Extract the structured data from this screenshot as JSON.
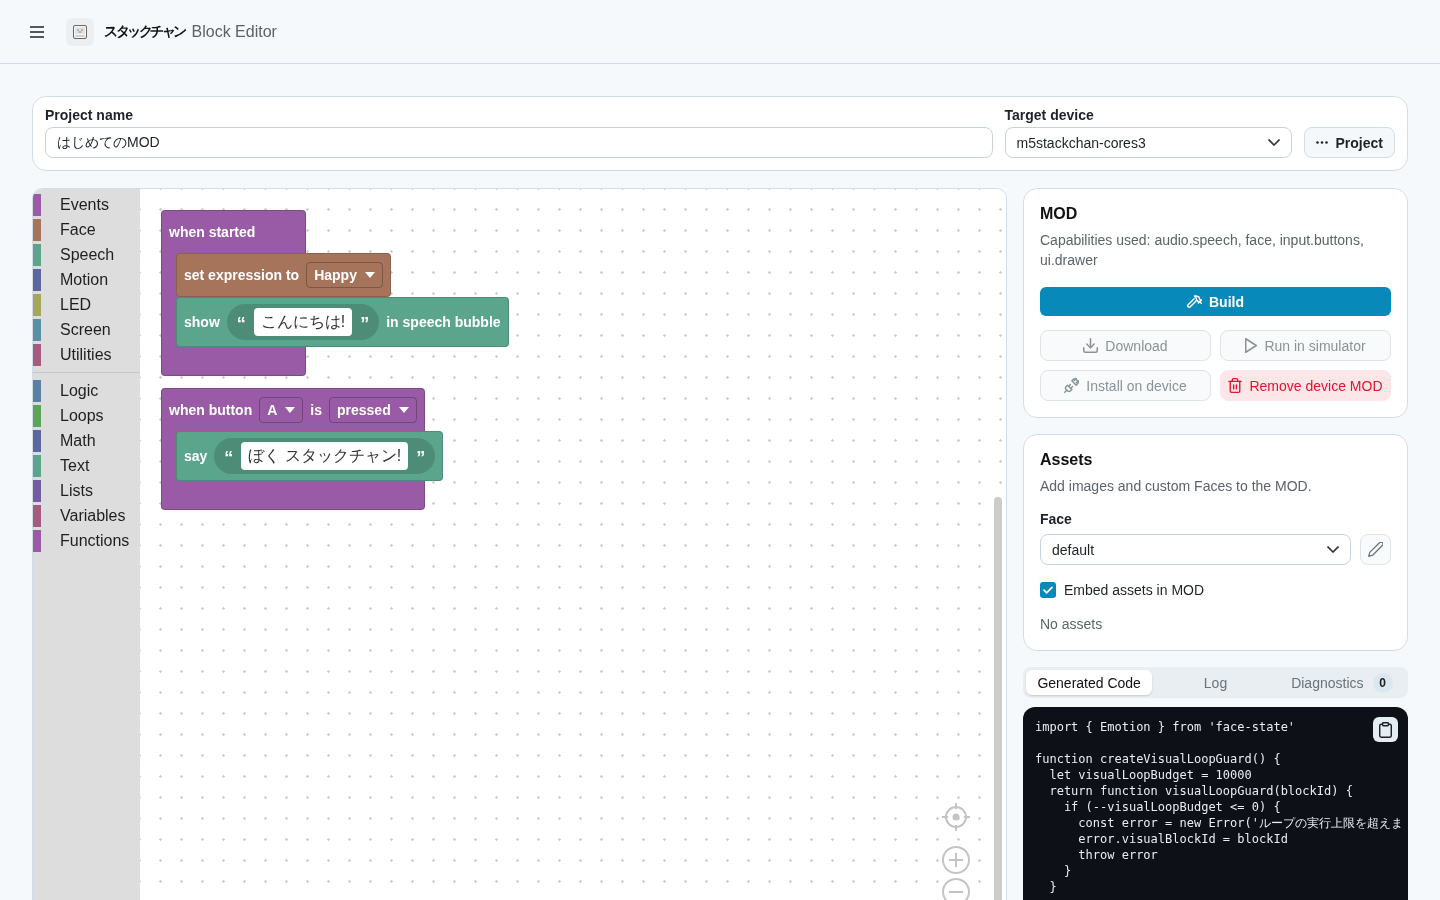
{
  "header": {
    "brand": "スタックチャン",
    "title": "Block Editor"
  },
  "project": {
    "name_label": "Project name",
    "name_value": "はじめてのMOD",
    "device_label": "Target device",
    "device_value": "m5stackchan-cores3",
    "menu_button": "Project"
  },
  "workspace": {
    "toolbox": {
      "sections": [
        {
          "categories": [
            {
              "label": "Events",
              "color": "#995ba5"
            },
            {
              "label": "Face",
              "color": "#a5745b"
            },
            {
              "label": "Speech",
              "color": "#5ba58c"
            },
            {
              "label": "Motion",
              "color": "#5b67a5"
            },
            {
              "label": "LED",
              "color": "#a5a55b"
            },
            {
              "label": "Screen",
              "color": "#5b8fa5"
            },
            {
              "label": "Utilities",
              "color": "#a55b80"
            }
          ]
        },
        {
          "categories": [
            {
              "label": "Logic",
              "color": "#5b80a5"
            },
            {
              "label": "Loops",
              "color": "#5ba55b"
            },
            {
              "label": "Math",
              "color": "#5b67a5"
            },
            {
              "label": "Text",
              "color": "#5ba58c"
            },
            {
              "label": "Lists",
              "color": "#745ba5"
            },
            {
              "label": "Variables",
              "color": "#a55b80"
            },
            {
              "label": "Functions",
              "color": "#995ba5"
            }
          ]
        }
      ]
    },
    "scripts": [
      {
        "color": "#995ba5",
        "parts": [
          {
            "kind": "label",
            "text": "when started"
          }
        ],
        "body": [
          {
            "color": "#a5745b",
            "parts": [
              {
                "kind": "label",
                "text": "set expression to"
              },
              {
                "kind": "dropdown",
                "text": "Happy"
              }
            ]
          },
          {
            "color": "#5ba58c",
            "parts": [
              {
                "kind": "label",
                "text": "show"
              },
              {
                "kind": "string",
                "open": "“",
                "text": "こんにちは!",
                "close": "”"
              },
              {
                "kind": "label",
                "text": "in speech bubble"
              }
            ]
          }
        ]
      },
      {
        "color": "#995ba5",
        "parts": [
          {
            "kind": "label",
            "text": "when button"
          },
          {
            "kind": "dropdown",
            "text": "A"
          },
          {
            "kind": "label",
            "text": "is"
          },
          {
            "kind": "dropdown",
            "text": "pressed"
          }
        ],
        "body": [
          {
            "color": "#5ba58c",
            "parts": [
              {
                "kind": "label",
                "text": "say"
              },
              {
                "kind": "string",
                "open": "“",
                "text": "ぼく スタックチャン!",
                "close": "”"
              }
            ]
          }
        ]
      }
    ]
  },
  "mod": {
    "title": "MOD",
    "description": "Capabilities used: audio.speech, face, input.buttons, ui.drawer",
    "buttons": [
      {
        "label": "Build",
        "kind": "primary",
        "disabled": false
      },
      {
        "label": "Download",
        "kind": "secondary",
        "disabled": true
      },
      {
        "label": "Run in simulator",
        "kind": "secondary",
        "disabled": true
      },
      {
        "label": "Install on device",
        "kind": "secondary",
        "disabled": true
      },
      {
        "label": "Remove device MOD",
        "kind": "danger",
        "disabled": false
      }
    ]
  },
  "assets": {
    "title": "Assets",
    "description": "Add images and custom Faces to the MOD.",
    "face_label": "Face",
    "face_value": "default",
    "embed": {
      "label": "Embed assets in MOD",
      "checked": true
    },
    "empty_text": "No assets"
  },
  "output": {
    "tabs": [
      {
        "label": "Generated Code",
        "selected": true
      },
      {
        "label": "Log",
        "selected": false
      },
      {
        "label": "Diagnostics",
        "selected": false,
        "count": "0"
      }
    ],
    "code": "import { Emotion } from 'face-state'\n\nfunction createVisualLoopGuard() {\n  let visualLoopBudget = 10000\n  return function visualLoopGuard(blockId) {\n    if (--visualLoopBudget <= 0) {\n      const error = new Error('ループの実行上限を超えま\n      error.visualBlockId = blockId\n      throw error\n    }\n  }"
  }
}
